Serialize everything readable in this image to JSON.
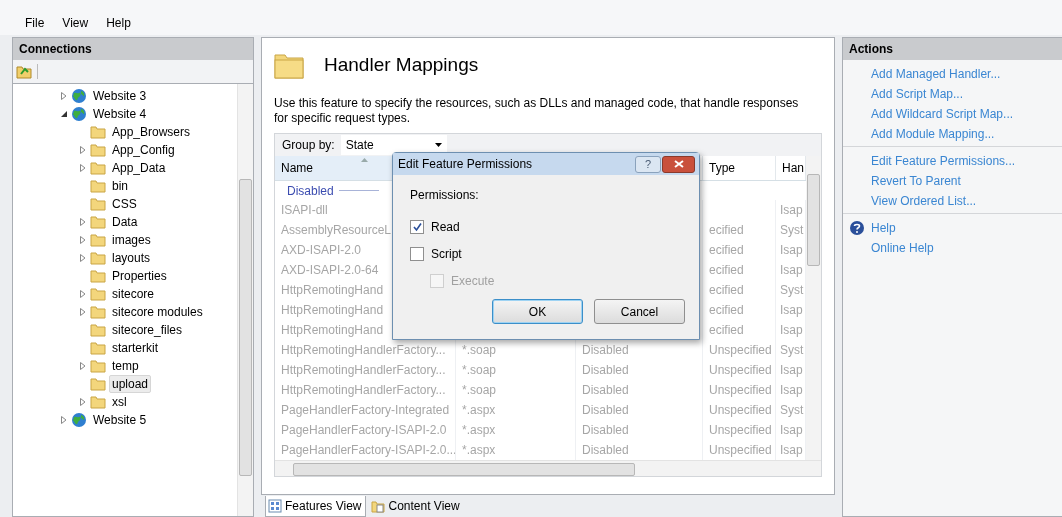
{
  "menu": [
    {
      "label": "File"
    },
    {
      "label": "View"
    },
    {
      "label": "Help"
    }
  ],
  "connections": {
    "title": "Connections",
    "tree": [
      {
        "label": "Website 3",
        "kind": "site",
        "expanded": false,
        "selected": false
      },
      {
        "label": "Website 4",
        "kind": "site",
        "expanded": true,
        "selected": false,
        "children": [
          {
            "label": "App_Browsers",
            "kind": "folder",
            "selected": false
          },
          {
            "label": "App_Config",
            "kind": "folder",
            "expanded": false,
            "selected": false
          },
          {
            "label": "App_Data",
            "kind": "folder",
            "expanded": false,
            "selected": false
          },
          {
            "label": "bin",
            "kind": "folder",
            "selected": false
          },
          {
            "label": "CSS",
            "kind": "folder",
            "selected": false
          },
          {
            "label": "Data",
            "kind": "folder",
            "expanded": false,
            "selected": false
          },
          {
            "label": "images",
            "kind": "folder",
            "expanded": false,
            "selected": false
          },
          {
            "label": "layouts",
            "kind": "folder",
            "expanded": false,
            "selected": false
          },
          {
            "label": "Properties",
            "kind": "folder",
            "selected": false
          },
          {
            "label": "sitecore",
            "kind": "folder",
            "expanded": false,
            "selected": false
          },
          {
            "label": "sitecore modules",
            "kind": "folder",
            "expanded": false,
            "selected": false
          },
          {
            "label": "sitecore_files",
            "kind": "folder",
            "selected": false
          },
          {
            "label": "starterkit",
            "kind": "folder",
            "selected": false
          },
          {
            "label": "temp",
            "kind": "folder",
            "expanded": false,
            "selected": false
          },
          {
            "label": "upload",
            "kind": "folder",
            "selected": true
          },
          {
            "label": "xsl",
            "kind": "folder",
            "expanded": false,
            "selected": false
          }
        ]
      },
      {
        "label": "Website 5",
        "kind": "site",
        "expanded": false,
        "selected": false
      }
    ]
  },
  "feature": {
    "title": "Handler Mappings",
    "description": "Use this feature to specify the resources, such as DLLs and managed code, that handle responses for specific request types.",
    "group_by": {
      "label": "Group by:",
      "value": "State"
    },
    "columns": [
      {
        "label": "Name",
        "sorted": true
      },
      {
        "label": "Type",
        "sorted": false
      },
      {
        "label": "Han",
        "sorted": false
      }
    ],
    "group": "Disabled",
    "rows": [
      {
        "name": "ISAPI-dll",
        "handler": "Isap"
      },
      {
        "name": "AssemblyResourceL",
        "type": "ecified",
        "handler": "Syst"
      },
      {
        "name": "AXD-ISAPI-2.0",
        "type": "ecified",
        "handler": "Isap"
      },
      {
        "name": "AXD-ISAPI-2.0-64",
        "type": "ecified",
        "handler": "Isap"
      },
      {
        "name": "HttpRemotingHand",
        "type": "ecified",
        "handler": "Syst"
      },
      {
        "name": "HttpRemotingHand",
        "type": "ecified",
        "handler": "Isap"
      },
      {
        "name": "HttpRemotingHand",
        "type": "ecified",
        "handler": "Isap"
      },
      {
        "name": "HttpRemotingHandlerFactory...",
        "column_2": "*.soap",
        "column_3": "Disabled",
        "type": "Unspecified",
        "handler": "Syst"
      },
      {
        "name": "HttpRemotingHandlerFactory...",
        "column_2": "*.soap",
        "column_3": "Disabled",
        "type": "Unspecified",
        "handler": "Isap"
      },
      {
        "name": "HttpRemotingHandlerFactory...",
        "column_2": "*.soap",
        "column_3": "Disabled",
        "type": "Unspecified",
        "handler": "Isap"
      },
      {
        "name": "PageHandlerFactory-Integrated",
        "column_2": "*.aspx",
        "column_3": "Disabled",
        "type": "Unspecified",
        "handler": "Syst"
      },
      {
        "name": "PageHandlerFactory-ISAPI-2.0",
        "column_2": "*.aspx",
        "column_3": "Disabled",
        "type": "Unspecified",
        "handler": "Isap"
      },
      {
        "name": "PageHandlerFactory-ISAPI-2.0...",
        "column_2": "*.aspx",
        "column_3": "Disabled",
        "type": "Unspecified",
        "handler": "Isap"
      }
    ]
  },
  "view_tabs": [
    {
      "label": "Features View",
      "selected": true
    },
    {
      "label": "Content View",
      "selected": false
    }
  ],
  "actions": {
    "title": "Actions",
    "groups": [
      [
        {
          "label": "Add Managed Handler..."
        },
        {
          "label": "Add Script Map..."
        },
        {
          "label": "Add Wildcard Script Map..."
        },
        {
          "label": "Add Module Mapping..."
        }
      ],
      [
        {
          "label": "Edit Feature Permissions..."
        },
        {
          "label": "Revert To Parent"
        },
        {
          "label": "View Ordered List..."
        }
      ],
      [
        {
          "label": "Help",
          "kind": "help"
        },
        {
          "label": "Online Help"
        }
      ]
    ]
  },
  "dialog": {
    "title": "Edit Feature Permissions",
    "help_glyph": "?",
    "section": "Permissions:",
    "options": [
      {
        "label": "Read",
        "checked": true,
        "disabled": false
      },
      {
        "label": "Script",
        "checked": false,
        "disabled": false,
        "children": [
          {
            "label": "Execute",
            "checked": false,
            "disabled": true
          }
        ]
      }
    ],
    "buttons": [
      {
        "label": "OK",
        "default": true
      },
      {
        "label": "Cancel",
        "default": false
      }
    ]
  }
}
